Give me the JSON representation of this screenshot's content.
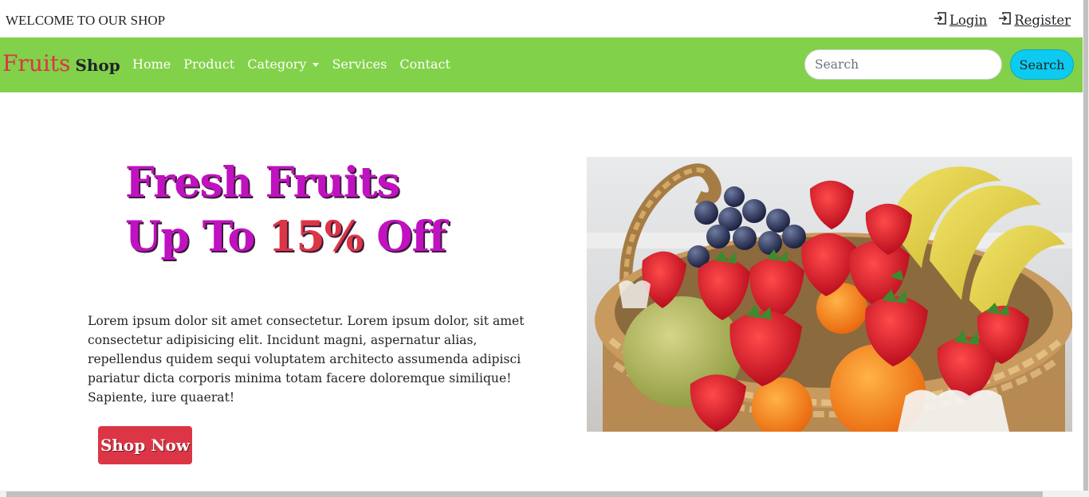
{
  "topbar": {
    "welcome": "WELCOME TO OUR SHOP",
    "login_label": "Login",
    "register_label": "Register",
    "login_icon": "sign-in-icon",
    "register_icon": "sign-in-icon"
  },
  "navbar": {
    "brand_primary": "Fruits",
    "brand_secondary": "Shop",
    "items": [
      {
        "label": "Home"
      },
      {
        "label": "Product"
      },
      {
        "label": "Category",
        "dropdown": true
      },
      {
        "label": "Services"
      },
      {
        "label": "Contact"
      }
    ],
    "search_placeholder": "Search",
    "search_value": "",
    "search_button": "Search",
    "background_color": "#82d14a"
  },
  "hero": {
    "headline_line1": "Fresh Fruits",
    "headline_line2_prefix": "Up To ",
    "headline_line2_percent": "15%",
    "headline_line2_suffix": " Off",
    "description": "Lorem ipsum dolor sit amet consectetur. Lorem ipsum dolor, sit amet consectetur adipisicing elit. Incidunt magni, aspernatur alias, repellendus quidem sequi voluptatem architecto assumenda adipisci pariatur dicta corporis minima totam facere doloremque similique! Sapiente, iure quaerat!",
    "cta_label": "Shop Now",
    "cta_color": "#dc3545",
    "headline_color": "#c012c0",
    "image_subject": "fruit-basket"
  }
}
